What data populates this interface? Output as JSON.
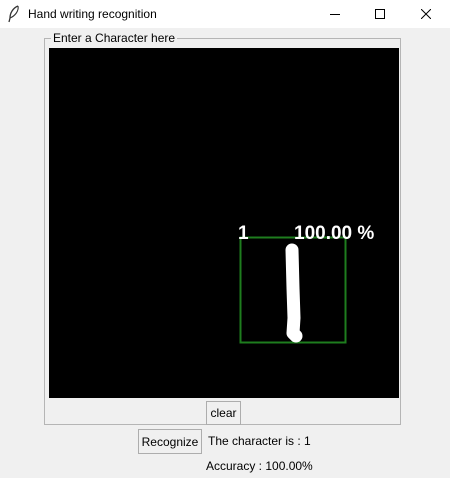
{
  "window": {
    "title": "Hand writing recognition",
    "icon": "feather-icon",
    "controls": [
      "minimize-icon",
      "maximize-icon",
      "close-icon"
    ]
  },
  "frame": {
    "label": "Enter a Character here"
  },
  "canvas": {
    "background": "#000000",
    "box_color": "#1e7d1e",
    "stroke_color": "#ffffff",
    "prediction": {
      "digit": "1",
      "confidence": "100.00 %"
    }
  },
  "buttons": {
    "clear": "clear",
    "recognize": "Recognize"
  },
  "result": {
    "character_text": "The character is : 1",
    "accuracy_text": "Accuracy : 100.00%"
  }
}
